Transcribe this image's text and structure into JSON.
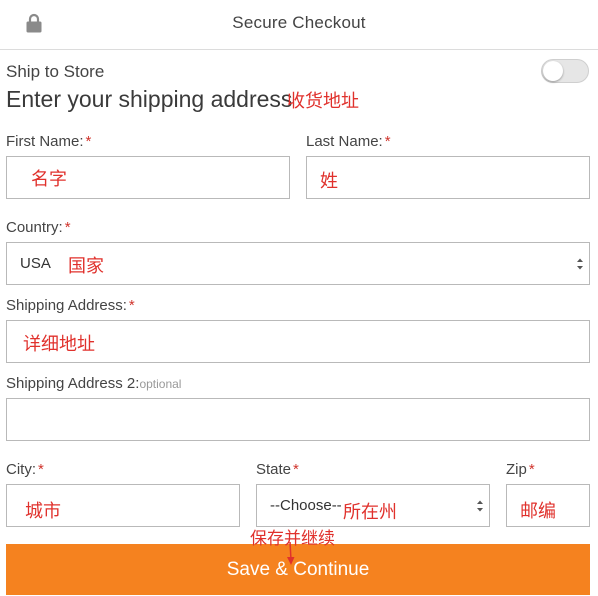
{
  "header": {
    "title": "Secure Checkout",
    "icon": "lock-icon"
  },
  "ship_to_store": {
    "label": "Ship to Store",
    "enabled": false
  },
  "heading": {
    "text": "Enter your shipping address",
    "annotation": "收货地址"
  },
  "required_mark": "*",
  "fields": {
    "first_name": {
      "label": "First Name:",
      "annotation": "名字"
    },
    "last_name": {
      "label": "Last Name:",
      "annotation": "姓"
    },
    "country": {
      "label": "Country:",
      "value": "USA",
      "annotation": "国家"
    },
    "shipping_address": {
      "label": "Shipping Address:",
      "annotation": "详细地址"
    },
    "shipping_address_2": {
      "label": "Shipping Address 2:",
      "optional": "optional"
    },
    "city": {
      "label": "City:",
      "annotation": "城市"
    },
    "state": {
      "label": "State",
      "value": "--Choose--",
      "annotation": "所在州"
    },
    "zip": {
      "label": "Zip",
      "annotation": "邮编"
    }
  },
  "save_button": {
    "label": "Save & Continue",
    "annotation": "保存并继续"
  },
  "colors": {
    "accent": "#f5821f",
    "required": "#d0342c",
    "annotation": "#e0312c"
  }
}
